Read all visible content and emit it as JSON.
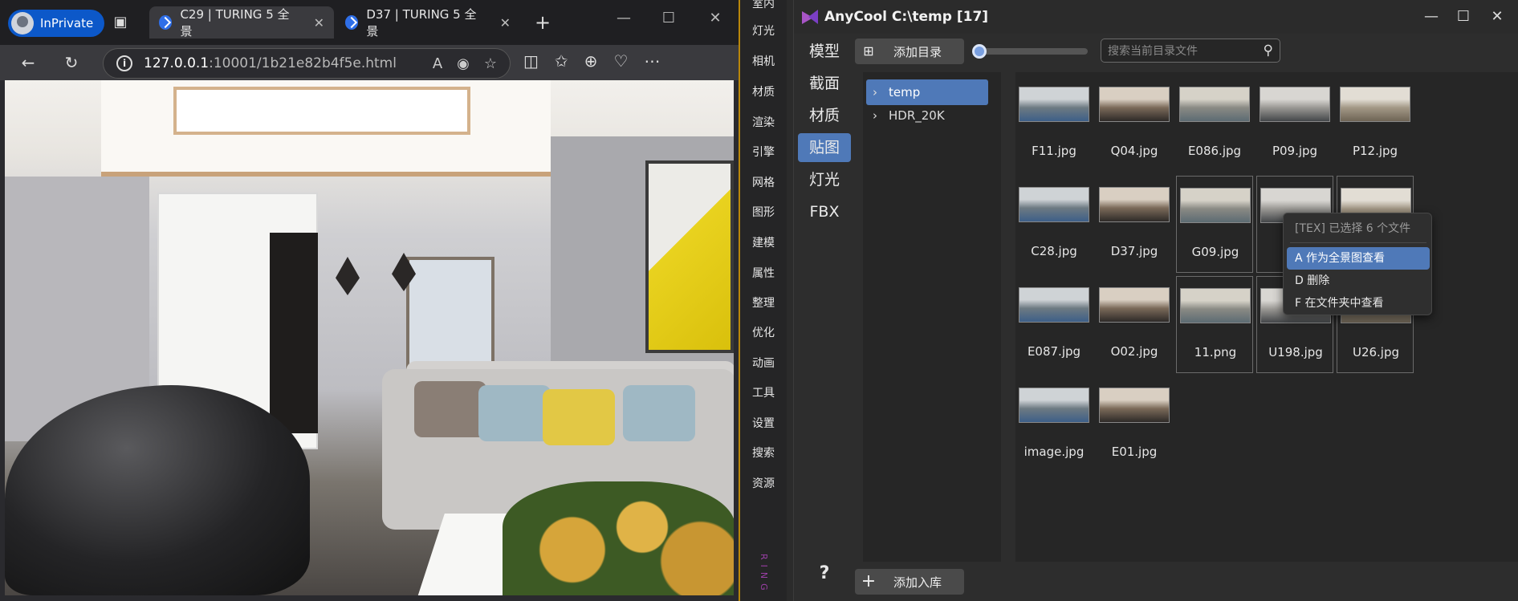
{
  "browser": {
    "inprivate_label": "InPrivate",
    "tabs": [
      {
        "title": "C29 | TURING 5 全景",
        "active": true
      },
      {
        "title": "D37 | TURING 5 全景",
        "active": false
      }
    ],
    "address": {
      "host": "127.0.0.1",
      "path": ":10001/1b21e82b4f5e.html"
    }
  },
  "menu_strip": {
    "items": [
      "室内",
      "灯光",
      "相机",
      "材质",
      "渲染",
      "引擎",
      "网格",
      "图形",
      "建模",
      "属性",
      "整理",
      "优化",
      "动画",
      "工具",
      "设置",
      "搜索",
      "资源"
    ],
    "vertical_text": "RING"
  },
  "app": {
    "title": "AnyCool C:\\temp  [17]",
    "nav": [
      "模型",
      "截面",
      "材质",
      "贴图",
      "灯光",
      "FBX"
    ],
    "nav_active": "贴图",
    "add_dir_label": "添加目录",
    "search_placeholder": "搜索当前目录文件",
    "add_to_lib_label": "添加入库",
    "help_label": "?",
    "tree": [
      {
        "label": "temp",
        "active": true
      },
      {
        "label": "HDR_20K",
        "active": false
      }
    ],
    "files": [
      {
        "name": "F11.jpg",
        "selected": false
      },
      {
        "name": "Q04.jpg",
        "selected": false
      },
      {
        "name": "E086.jpg",
        "selected": false
      },
      {
        "name": "P09.jpg",
        "selected": false
      },
      {
        "name": "P12.jpg",
        "selected": false
      },
      {
        "name": "C28.jpg",
        "selected": false
      },
      {
        "name": "D37.jpg",
        "selected": false
      },
      {
        "name": "G09.jpg",
        "selected": true
      },
      {
        "name": "",
        "selected": true
      },
      {
        "name": "",
        "selected": true
      },
      {
        "name": "E087.jpg",
        "selected": false
      },
      {
        "name": "O02.jpg",
        "selected": false
      },
      {
        "name": "11.png",
        "selected": true
      },
      {
        "name": "U198.jpg",
        "selected": true
      },
      {
        "name": "U26.jpg",
        "selected": true
      },
      {
        "name": "image.jpg",
        "selected": false
      },
      {
        "name": "E01.jpg",
        "selected": false
      }
    ],
    "context_menu": {
      "header": "[TEX] 已选择 6 个文件",
      "items": [
        "A 作为全景图查看",
        "D 删除",
        "F 在文件夹中查看"
      ],
      "active_index": 0
    }
  },
  "colors": {
    "accent": "#4f79b8",
    "inprivate": "#0c58c9",
    "logo": "#a855c7"
  }
}
